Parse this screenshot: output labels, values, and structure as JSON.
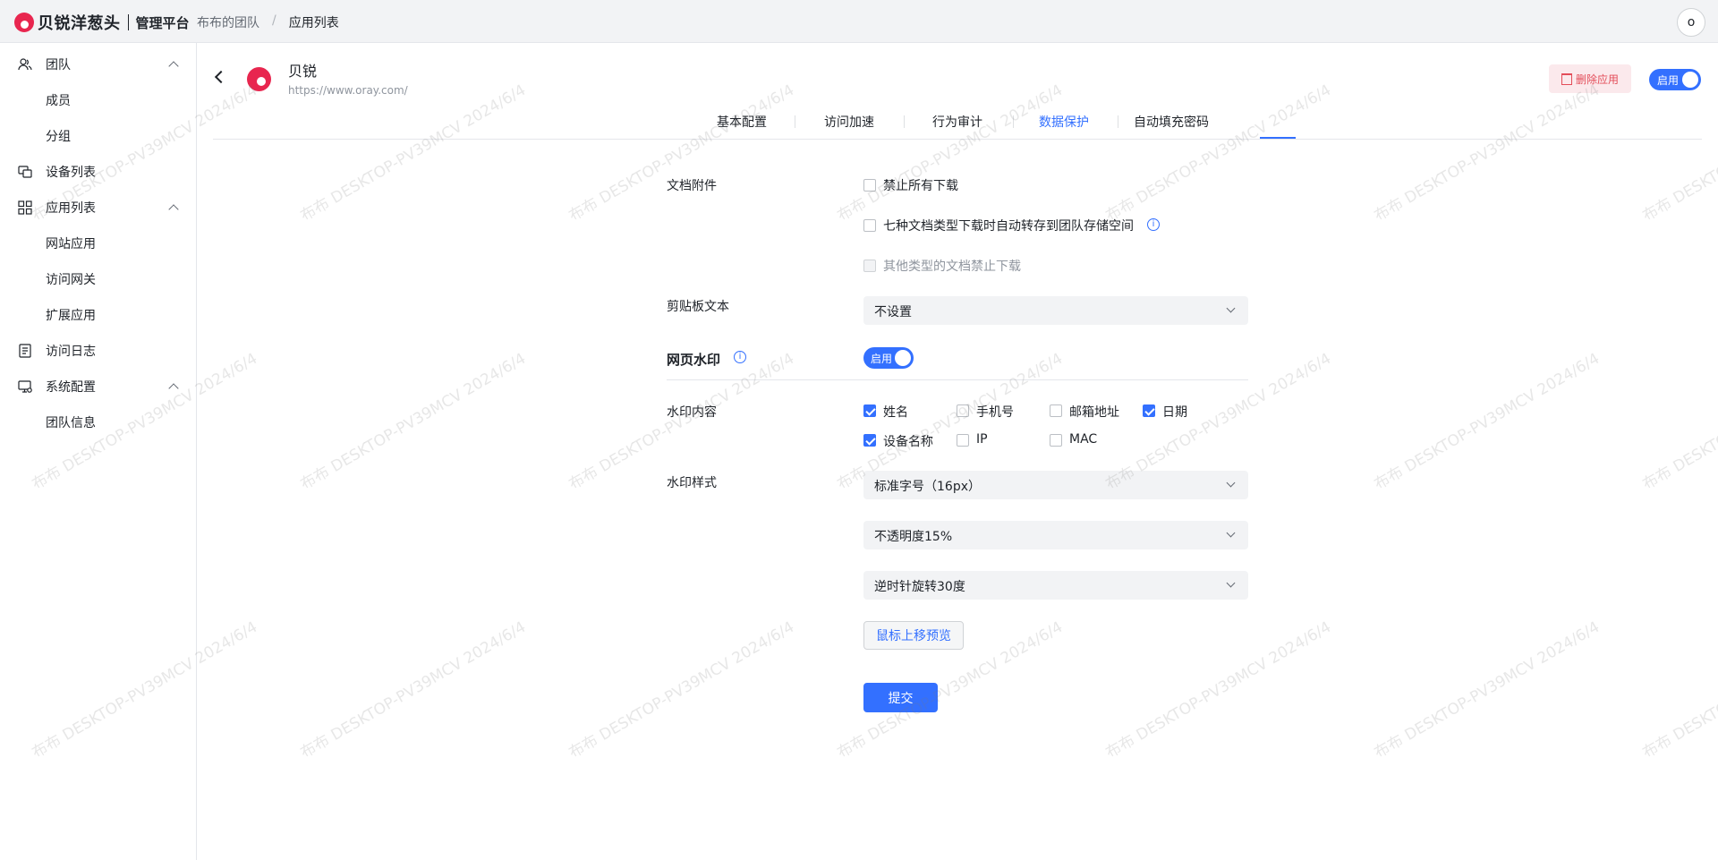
{
  "topbar": {
    "brand": "贝锐洋葱头",
    "subtitle": "管理平台",
    "breadcrumb": [
      "布布的团队",
      "应用列表"
    ],
    "avatar_letter": "o"
  },
  "sidebar": {
    "items": [
      {
        "label": "团队",
        "icon": "team-icon"
      },
      {
        "label": "成员"
      },
      {
        "label": "分组"
      },
      {
        "label": "设备列表",
        "icon": "devices-icon"
      },
      {
        "label": "应用列表",
        "icon": "apps-grid-icon"
      },
      {
        "label": "网站应用"
      },
      {
        "label": "访问网关"
      },
      {
        "label": "扩展应用"
      },
      {
        "label": "访问日志",
        "icon": "log-icon"
      },
      {
        "label": "系统配置",
        "icon": "settings-monitor-icon"
      },
      {
        "label": "团队信息"
      }
    ]
  },
  "app": {
    "name": "贝锐",
    "url": "https://www.oray.com/",
    "delete_label": "删除应用",
    "toggle_label": "启用"
  },
  "tabs": [
    {
      "label": "基本配置"
    },
    {
      "label": "访问加速"
    },
    {
      "label": "行为审计"
    },
    {
      "label": "数据保护",
      "active": true
    },
    {
      "label": "自动填充密码"
    }
  ],
  "form": {
    "doc_label": "文档附件",
    "doc_options": [
      "禁止所有下载",
      "七种文档类型下载时自动转存到团队存储空间",
      "其他类型的文档禁止下载"
    ],
    "clipboard_label": "剪贴板文本",
    "clipboard_value": "不设置",
    "watermark_title": "网页水印",
    "watermark_toggle": "启用",
    "wm_content_label": "水印内容",
    "wm_content_options": [
      {
        "label": "姓名",
        "checked": true
      },
      {
        "label": "手机号",
        "checked": false
      },
      {
        "label": "邮箱地址",
        "checked": false
      },
      {
        "label": "日期",
        "checked": true
      },
      {
        "label": "设备名称",
        "checked": true
      },
      {
        "label": "IP",
        "checked": false
      },
      {
        "label": "MAC",
        "checked": false
      }
    ],
    "wm_style_label": "水印样式",
    "font_size_value": "标准字号（16px）",
    "opacity_value": "不透明度15%",
    "rotate_value": "逆时针旋转30度",
    "preview_label": "鼠标上移预览",
    "submit_label": "提交"
  },
  "watermark_text": "布布 DESKTOP-PV39MCV 2024/6/4",
  "colors": {
    "primary": "#3370ff",
    "brand": "#e8264f",
    "danger": "#e34d59"
  }
}
